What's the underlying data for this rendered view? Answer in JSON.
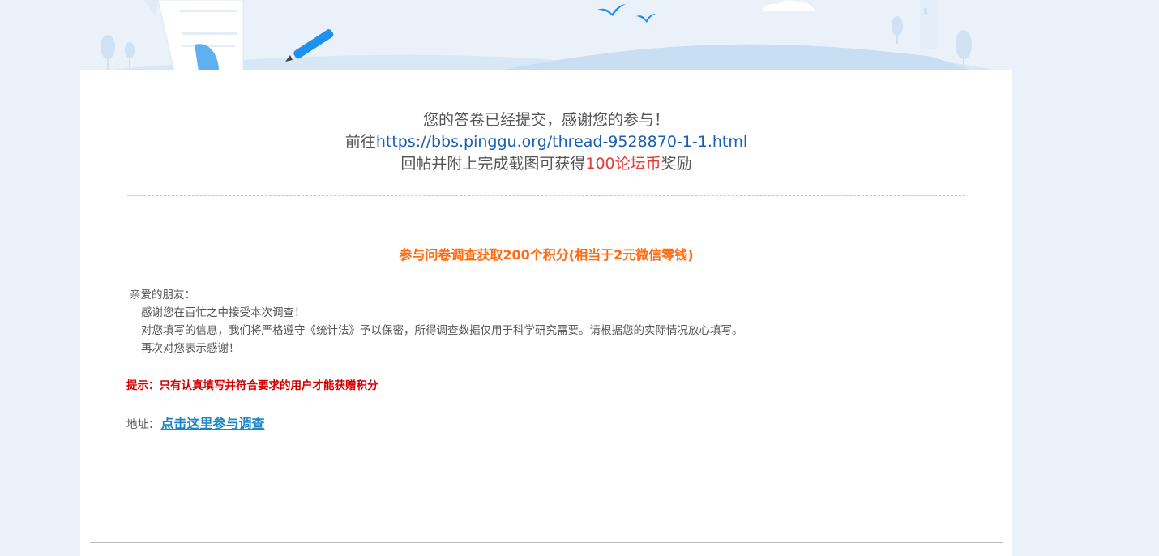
{
  "thanks": {
    "line1": "您的答卷已经提交，感谢您的参与！",
    "line2_prefix": "前往",
    "line2_link": "https://bbs.pinggu.org/thread-9528870-1-1.html",
    "line3_prefix": "回帖并附上完成截图可获得",
    "line3_reward": "100论坛币",
    "line3_suffix": "奖励"
  },
  "promo": {
    "title": "参与问卷调查获取200个积分(相当于2元微信零钱)"
  },
  "letter": {
    "greeting": "亲爱的朋友：",
    "lines": [
      "感谢您在百忙之中接受本次调查！",
      "对您填写的信息，我们将严格遵守《统计法》予以保密，所得调查数据仅用于科学研究需要。请根据您的实际情况放心填写。",
      "再次对您表示感谢！"
    ]
  },
  "hint": "提示：只有认真填写并符合要求的用户才能获赠积分",
  "address": {
    "label": "地址：",
    "link_text": "点击这里参与调查"
  },
  "colors": {
    "background": "#eaf1f8",
    "reward": "#e53935",
    "promo": "#ff6a10",
    "hint": "#d40000",
    "link": "#1a86c8"
  }
}
